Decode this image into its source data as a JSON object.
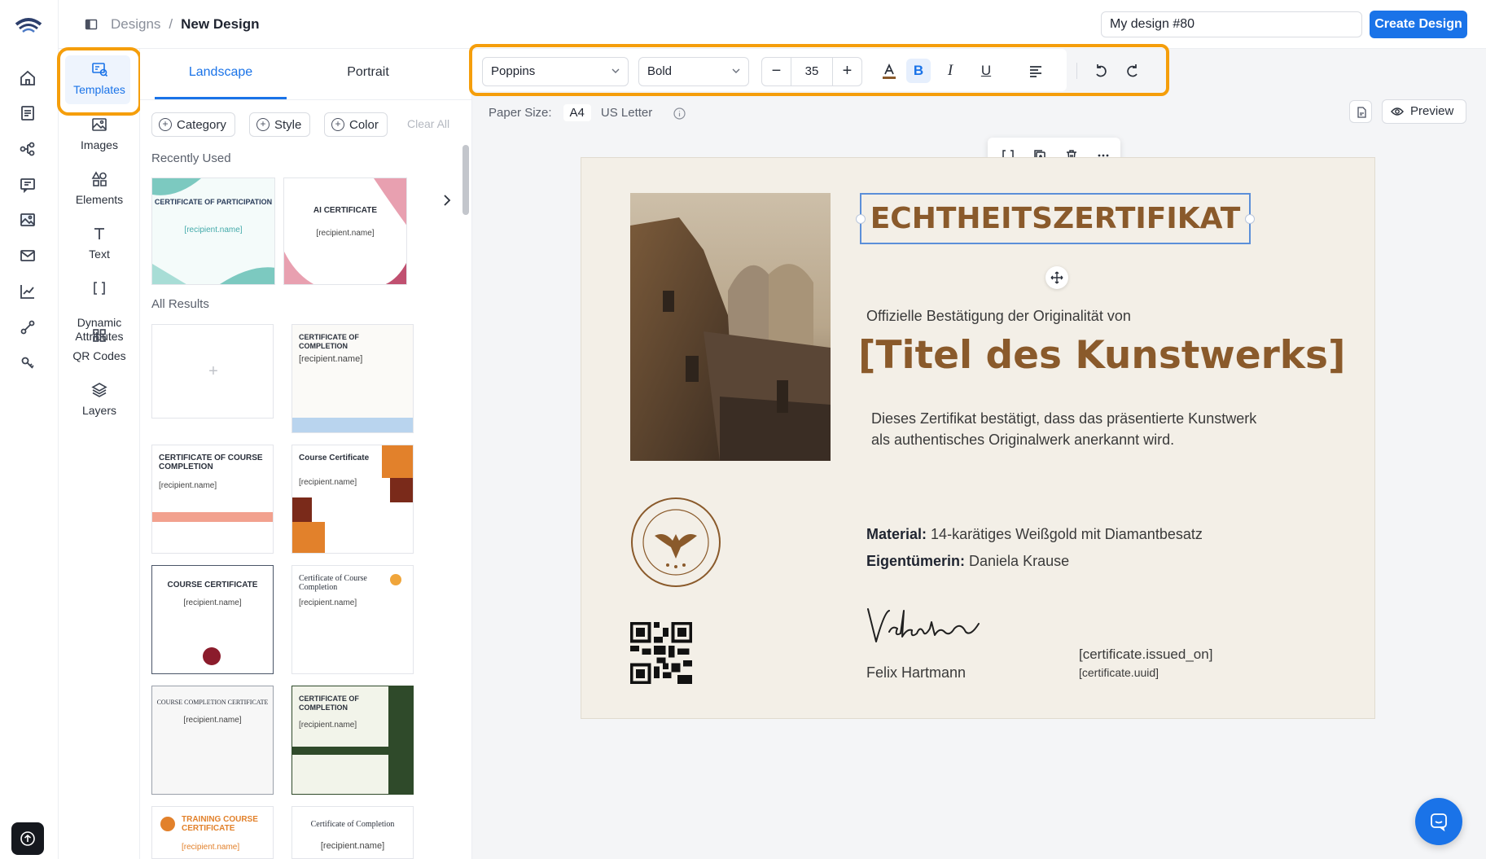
{
  "header": {
    "breadcrumb_root": "Designs",
    "breadcrumb_sep": "/",
    "breadcrumb_current": "New Design",
    "design_name_value": "My design #80",
    "create_button": "Create Design"
  },
  "rail": {
    "icons": [
      "home-icon",
      "document-list-icon",
      "workflow-icon",
      "message-icon",
      "image-icon",
      "mail-icon",
      "chart-icon",
      "integration-icon",
      "settings-key-icon"
    ]
  },
  "tools": {
    "items": [
      {
        "label": "Templates",
        "icon": "templates-icon"
      },
      {
        "label": "Images",
        "icon": "image-icon"
      },
      {
        "label": "Elements",
        "icon": "elements-icon"
      },
      {
        "label": "Text",
        "icon": "text-icon"
      },
      {
        "label": "Dynamic\nAttributes",
        "icon": "brackets-icon"
      },
      {
        "label": "QR Codes",
        "icon": "qr-grid-icon"
      },
      {
        "label": "Layers",
        "icon": "layers-icon"
      }
    ]
  },
  "panel": {
    "tabs": [
      "Landscape",
      "Portrait"
    ],
    "filters": [
      "Category",
      "Style",
      "Color"
    ],
    "clear_all": "Clear All",
    "recently_used_label": "Recently Used",
    "all_results_label": "All Results",
    "recent": [
      {
        "title": "CERTIFICATE OF PARTICIPATION",
        "name": "[recipient.name]"
      },
      {
        "title": "AI CERTIFICATE",
        "name": "[recipient.name]"
      }
    ],
    "results": [
      {
        "title": "",
        "name": "+"
      },
      {
        "title": "CERTIFICATE OF COMPLETION",
        "name": "[recipient.name]"
      },
      {
        "title": "CERTIFICATE OF COURSE COMPLETION",
        "name": "[recipient.name]"
      },
      {
        "title": "Course Certificate",
        "name": "[recipient.name]"
      },
      {
        "title": "COURSE CERTIFICATE",
        "name": "[recipient.name]"
      },
      {
        "title": "Certificate of Course Completion",
        "name": "[recipient.name]"
      },
      {
        "title": "COURSE COMPLETION CERTIFICATE",
        "name": "[recipient.name]"
      },
      {
        "title": "CERTIFICATE OF COMPLETION",
        "name": "[recipient.name]"
      },
      {
        "title": "TRAINING COURSE CERTIFICATE",
        "name": "[recipient.name]"
      },
      {
        "title": "Certificate of Completion",
        "name": "[recipient.name]"
      }
    ]
  },
  "toolbar": {
    "font_family": "Poppins",
    "font_weight": "Bold",
    "font_size": "35",
    "minus": "−",
    "plus": "+",
    "bold": "B",
    "italic": "I",
    "underline": "U"
  },
  "paper": {
    "label": "Paper Size:",
    "options": [
      "A4",
      "US Letter"
    ],
    "selected": "A4",
    "preview_label": "Preview"
  },
  "certificate": {
    "title": "ECHTHEITSZERTIFIKAT",
    "subtitle": "Offizielle Bestätigung der Originalität von",
    "artwork": "[Titel des Kunstwerks]",
    "body_line1": "Dieses Zertifikat bestätigt, dass das präsentierte Kunstwerk",
    "body_line2": "als authentisches Originalwerk anerkannt wird.",
    "material_label": "Material:",
    "material_value": "14-karätiges Weißgold mit Diamantbesatz",
    "owner_label": "Eigentümerin:",
    "owner_value": "Daniela Krause",
    "signer": "Felix Hartmann",
    "issued_on": "[certificate.issued_on]",
    "uuid": "[certificate.uuid]"
  },
  "colors": {
    "accent": "#1a73e8",
    "highlight_ring": "#f59e0b",
    "certificate_brown": "#8a5a2b",
    "certificate_bg": "#f3efe7"
  }
}
